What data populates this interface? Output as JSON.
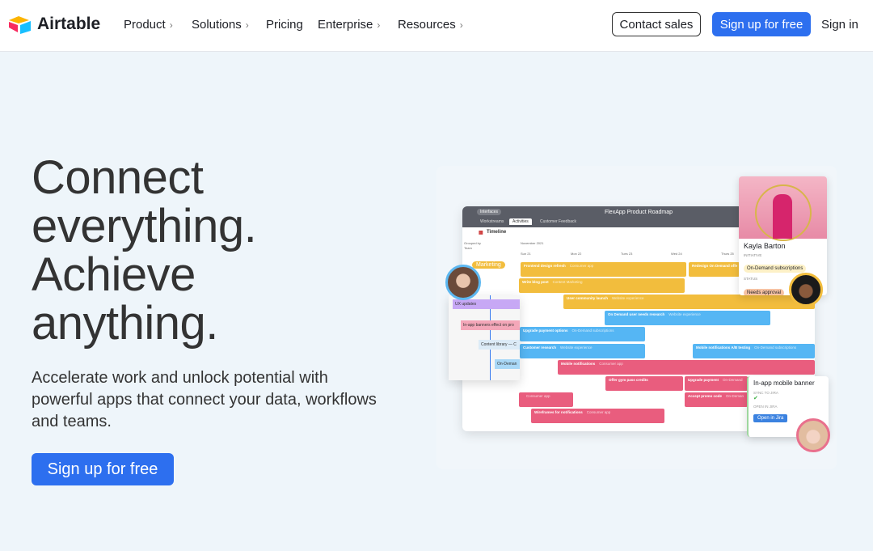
{
  "nav": {
    "brand": "Airtable",
    "items": [
      {
        "label": "Product",
        "chevron": true
      },
      {
        "label": "Solutions",
        "chevron": true
      },
      {
        "label": "Pricing",
        "chevron": false
      },
      {
        "label": "Enterprise",
        "chevron": true
      },
      {
        "label": "Resources",
        "chevron": true
      }
    ],
    "contact": "Contact sales",
    "signup": "Sign up for free",
    "signin": "Sign in"
  },
  "hero": {
    "title_lines": [
      "Connect",
      "everything.",
      "Achieve",
      "anything."
    ],
    "subtitle": "Accelerate work and unlock potential with powerful apps that connect your data, workflows and teams.",
    "cta": "Sign up for free"
  },
  "mockup": {
    "title": "FlexApp Product Roadmap",
    "interfaces": "Interfaces",
    "tabs": [
      "Workstreams",
      "Activities",
      "Customer Feedback"
    ],
    "view": "Timeline",
    "grouped_by": "Grouped by",
    "group_field": "Team",
    "month": "November 2021",
    "days": [
      "Sun 21",
      "Mon 22",
      "Tues 23",
      "Wed 24",
      "Thurs 25"
    ],
    "group": "Marketing",
    "bars": [
      [
        "Frontend design refresh",
        "Consumer app"
      ],
      [
        "Redesign On Demand offe",
        ""
      ],
      [
        "Write blog post",
        "Content Marketing"
      ],
      [
        "User community launch",
        "Website experience"
      ],
      [
        "On Demand user needs research",
        "Website experience"
      ],
      [
        "Upgrade payment options",
        "On-Demand subscriptions"
      ],
      [
        "Customer research",
        "Website experience"
      ],
      [
        "Mobile notifications A/B testing",
        "On-Demand subscriptions"
      ],
      [
        "Mobile notifications",
        "Consumer app"
      ],
      [
        "Offer gym pass credits",
        ""
      ],
      [
        "Upgrade payment",
        "On-Demand"
      ],
      [
        "",
        "Consumer app"
      ],
      [
        "Accept promo code",
        "On-Deman"
      ],
      [
        "Wireframes for notifications",
        "Consumer app"
      ]
    ],
    "overlay": [
      "UX updates",
      "In-app banners effect on pro",
      "Content library — C",
      "On-Deman"
    ],
    "profile": {
      "name": "Kayla Barton",
      "initiative_label": "INITIATIVE",
      "initiative": "On-Demand subscriptions",
      "status_label": "STATUS",
      "status": "Needs approval"
    },
    "jira": {
      "title": "In-app mobile banner",
      "sync_label": "SYNC TO JIRA",
      "open_label": "OPEN IN JIRA",
      "button": "Open in Jira"
    }
  },
  "colors": {
    "accent": "#2d6fef",
    "yellow": "#f2bd3d",
    "blue": "#55b6f4",
    "pink": "#e95d7e",
    "purple": "#c7a8f5"
  }
}
